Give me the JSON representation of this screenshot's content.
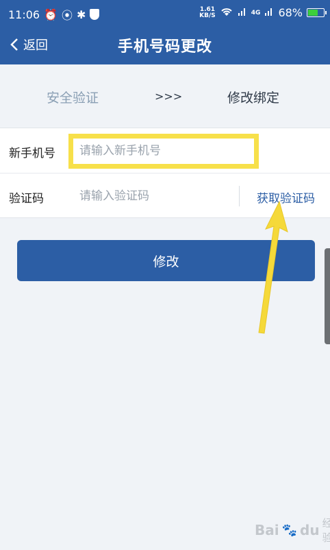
{
  "status_bar": {
    "time": "11:06",
    "net_speed_top": "1.61",
    "net_speed_bottom": "KB/S",
    "signal1": " Ιıl",
    "signal2": "4G",
    "battery_text": "68%",
    "battery_level": 0.68
  },
  "nav": {
    "back_label": "返回",
    "title": "手机号码更改"
  },
  "steps": {
    "step1": "安全验证",
    "separator": ">>>",
    "step2": "修改绑定"
  },
  "form": {
    "phone_label": "新手机号",
    "phone_placeholder": "请输入新手机号",
    "code_label": "验证码",
    "code_placeholder": "请输入验证码",
    "get_code_label": "获取验证码"
  },
  "submit_label": "修改",
  "watermark": {
    "brand": "Bai",
    "paw": "du",
    "site": "经验"
  },
  "colors": {
    "primary": "#2c5ea5",
    "highlight": "#f7e04a",
    "background": "#f0f3f7"
  }
}
